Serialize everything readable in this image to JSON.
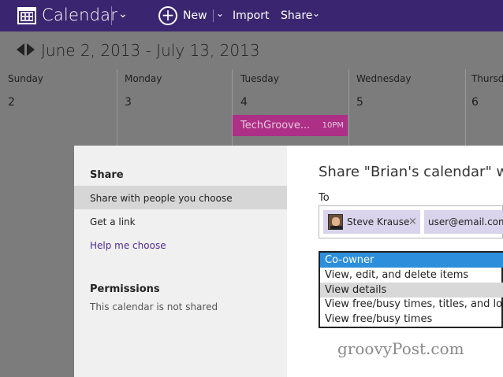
{
  "app": {
    "title": "Calendar",
    "toolbar": {
      "new_label": "New",
      "import_label": "Import",
      "share_label": "Share"
    }
  },
  "calendar": {
    "date_range": "June 2, 2013 - July 13, 2013",
    "days": [
      {
        "name": "Sunday",
        "number": "2"
      },
      {
        "name": "Monday",
        "number": "3"
      },
      {
        "name": "Tuesday",
        "number": "4"
      },
      {
        "name": "Wednesday",
        "number": "5"
      },
      {
        "name": "Thursday",
        "number": "6"
      }
    ],
    "event": {
      "title": "TechGroove...",
      "time": "10PM"
    }
  },
  "share_panel": {
    "share_heading": "Share",
    "items": [
      {
        "label": "Share with people you choose"
      },
      {
        "label": "Get a link"
      },
      {
        "label": "Help me choose"
      }
    ],
    "permissions_heading": "Permissions",
    "permissions_status": "This calendar is not shared"
  },
  "share_dialog": {
    "title": "Share \"Brian's calendar\" wi",
    "to_label": "To",
    "recipients": [
      {
        "name": "Steve Krause",
        "remove": "×"
      },
      {
        "name": "user@email.com"
      }
    ],
    "permission_options": [
      {
        "label": "Co-owner"
      },
      {
        "label": "View, edit, and delete items"
      },
      {
        "label": "View details"
      },
      {
        "label": "View free/busy times, titles, and loca"
      },
      {
        "label": "View free/busy times"
      }
    ]
  },
  "watermark": "groovyPost.com",
  "colors": {
    "topbar": "#3a2670",
    "event": "#ad2f86",
    "selected_option": "#2d8fdb",
    "chip": "#d9d4ec",
    "link": "#4d2a9b"
  }
}
